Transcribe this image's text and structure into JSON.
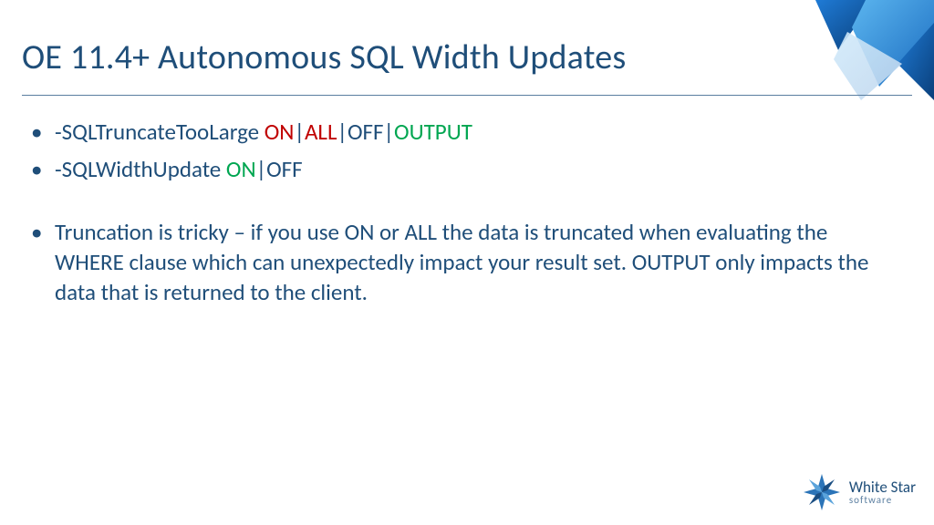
{
  "title": "OE 11.4+  Autonomous SQL Width Updates",
  "bullets": {
    "opt1": {
      "flag": "-SQLTruncateTooLarge ",
      "on": "ON",
      "all": "ALL",
      "off": "OFF",
      "output": "OUTPUT"
    },
    "opt2": {
      "flag": "-SQLWidthUpdate ",
      "on": "ON",
      "off": "OFF"
    },
    "note": "Truncation is tricky – if you use ON or ALL the data is truncated when evaluating the WHERE clause which can unexpectedly impact your result set.  OUTPUT only impacts the data that is returned to the client."
  },
  "brand": {
    "line1": "White Star",
    "line2": "software"
  }
}
